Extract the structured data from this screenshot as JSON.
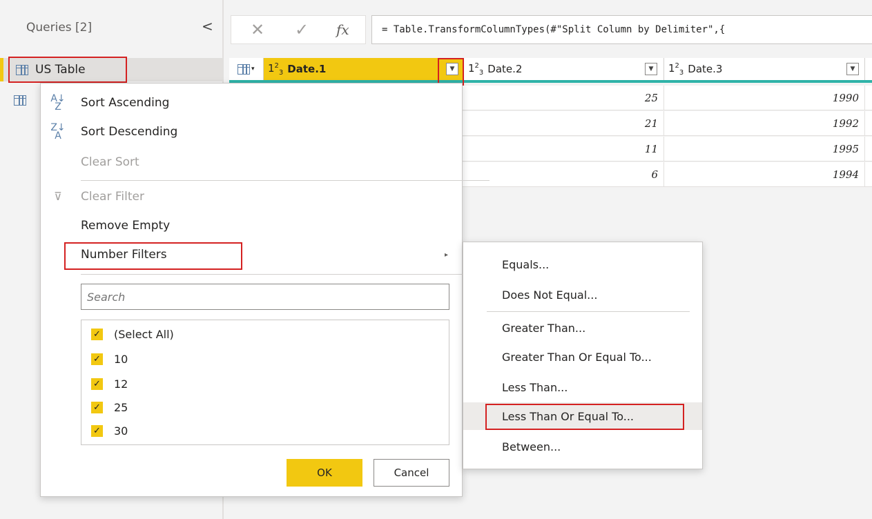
{
  "queries_pane": {
    "title": "Queries [2]",
    "collapse_glyph": "<",
    "items": [
      {
        "label": "US Table",
        "selected": true
      },
      {
        "label": ""
      }
    ]
  },
  "formula_bar": {
    "cancel_glyph": "✕",
    "confirm_glyph": "✓",
    "fx_label": "fx",
    "formula": "= Table.TransformColumnTypes(#\"Split Column by Delimiter\",{"
  },
  "grid": {
    "columns": [
      {
        "type_icon": "123",
        "name": "Date.1"
      },
      {
        "type_icon": "123",
        "name": "Date.2"
      },
      {
        "type_icon": "123",
        "name": "Date.3"
      }
    ],
    "rows": [
      {
        "date2": "25",
        "date3": "1990"
      },
      {
        "date2": "21",
        "date3": "1992"
      },
      {
        "date2": "11",
        "date3": "1995"
      },
      {
        "date2": "6",
        "date3": "1994"
      }
    ]
  },
  "filter_menu": {
    "sort_ascending": "Sort Ascending",
    "sort_descending": "Sort Descending",
    "clear_sort": "Clear Sort",
    "clear_filter": "Clear Filter",
    "remove_empty": "Remove Empty",
    "number_filters": "Number Filters",
    "search_placeholder": "Search",
    "values": [
      {
        "label": "(Select All)",
        "checked": true
      },
      {
        "label": "10",
        "checked": true
      },
      {
        "label": "12",
        "checked": true
      },
      {
        "label": "25",
        "checked": true
      },
      {
        "label": "30",
        "checked": true
      }
    ],
    "ok_label": "OK",
    "cancel_label": "Cancel"
  },
  "number_filters_submenu": {
    "items": [
      "Equals...",
      "Does Not Equal...",
      "Greater Than...",
      "Greater Than Or Equal To...",
      "Less Than...",
      "Less Than Or Equal To...",
      "Between..."
    ],
    "highlighted": "Less Than Or Equal To..."
  },
  "colors": {
    "accent_yellow": "#f2c811",
    "highlight_red": "#d42121",
    "teal_rule": "#2fb3a8"
  },
  "icons": {
    "table": "table-icon",
    "sort_asc": "sort-ascending-icon",
    "sort_desc": "sort-descending-icon",
    "clear_filter": "clear-filter-icon",
    "dropdown": "chevron-down-icon"
  }
}
